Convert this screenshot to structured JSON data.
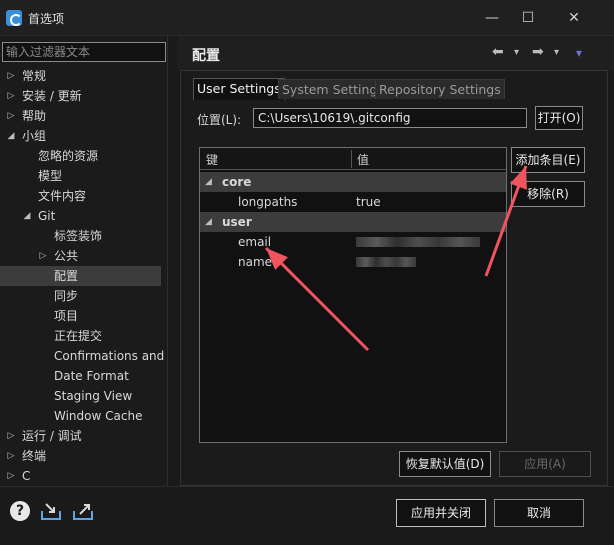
{
  "window": {
    "title": "首选项",
    "minimize_glyph": "—",
    "maximize_glyph": "☐",
    "close_glyph": "✕"
  },
  "filter": {
    "placeholder": "输入过滤器文本"
  },
  "tree": {
    "items": [
      {
        "label": "常规",
        "level": 0,
        "twisty": "▷"
      },
      {
        "label": "安装 / 更新",
        "level": 0,
        "twisty": "▷"
      },
      {
        "label": "帮助",
        "level": 0,
        "twisty": "▷"
      },
      {
        "label": "小组",
        "level": 0,
        "twisty": "◢"
      },
      {
        "label": "忽略的资源",
        "level": 1,
        "twisty": ""
      },
      {
        "label": "模型",
        "level": 1,
        "twisty": ""
      },
      {
        "label": "文件内容",
        "level": 1,
        "twisty": ""
      },
      {
        "label": "Git",
        "level": 1,
        "twisty": "◢"
      },
      {
        "label": "标签装饰",
        "level": 2,
        "twisty": ""
      },
      {
        "label": "公共",
        "level": 2,
        "twisty": "▷"
      },
      {
        "label": "配置",
        "level": 2,
        "twisty": "",
        "selected": true
      },
      {
        "label": "同步",
        "level": 2,
        "twisty": ""
      },
      {
        "label": "项目",
        "level": 2,
        "twisty": ""
      },
      {
        "label": "正在提交",
        "level": 2,
        "twisty": ""
      },
      {
        "label": "Confirmations and",
        "level": 2,
        "twisty": ""
      },
      {
        "label": "Date Format",
        "level": 2,
        "twisty": ""
      },
      {
        "label": "Staging View",
        "level": 2,
        "twisty": ""
      },
      {
        "label": "Window Cache",
        "level": 2,
        "twisty": ""
      },
      {
        "label": "运行 / 调试",
        "level": 0,
        "twisty": "▷"
      },
      {
        "label": "终端",
        "level": 0,
        "twisty": "▷"
      },
      {
        "label": "C",
        "level": 0,
        "twisty": "▷"
      }
    ]
  },
  "header": {
    "title": "配置",
    "back_glyph": "⬅",
    "forward_glyph": "➡",
    "dropdown_glyph": "▾",
    "menu_glyph": "▾"
  },
  "tabs": [
    {
      "label": "User Settings",
      "active": true
    },
    {
      "label": "System Settings",
      "active": false
    },
    {
      "label": "Repository Settings",
      "active": false
    }
  ],
  "location": {
    "label": "位置(L):",
    "value": "C:\\Users\\10619\\.gitconfig",
    "open_button": "打开(O)"
  },
  "table": {
    "columns": [
      "键",
      "值"
    ],
    "rows": [
      {
        "type": "group",
        "key": "core",
        "twisty": "◢"
      },
      {
        "type": "entry",
        "key": "longpaths",
        "value": "true"
      },
      {
        "type": "group",
        "key": "user",
        "twisty": "◢"
      },
      {
        "type": "entry",
        "key": "email",
        "value": ""
      },
      {
        "type": "entry",
        "key": "name",
        "value": ""
      }
    ]
  },
  "side_buttons": {
    "add": "添加条目(E)",
    "remove": "移除(R)"
  },
  "restore_buttons": {
    "restore_defaults": "恢复默认值(D)",
    "apply": "应用(A)"
  },
  "bottom": {
    "apply_close": "应用并关闭",
    "cancel": "取消",
    "help_glyph": "?"
  },
  "colors": {
    "annotation_arrow": "#f0555f",
    "selection": "#3c3c3c"
  }
}
